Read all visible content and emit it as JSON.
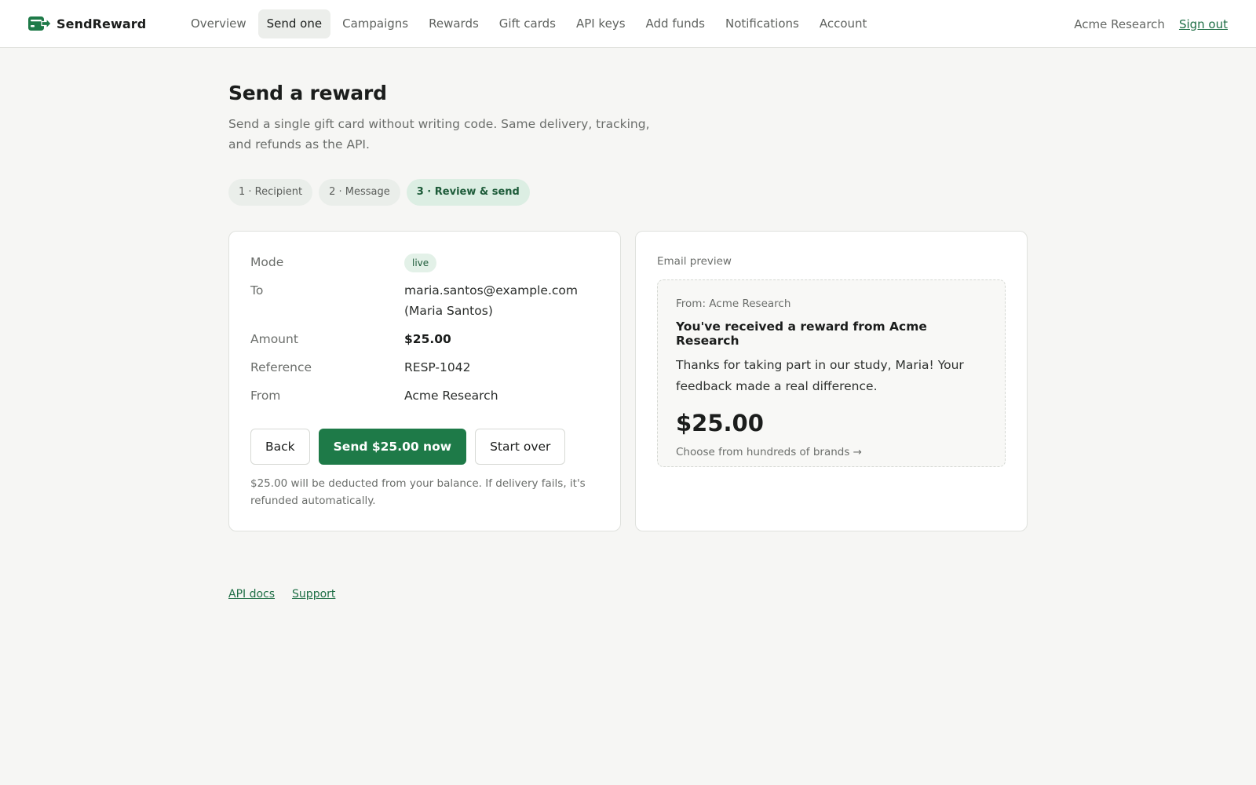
{
  "brand": {
    "name": "SendReward",
    "icon": "card-arrow-icon",
    "accent": "#1e7a48"
  },
  "nav": {
    "items": [
      {
        "label": "Overview"
      },
      {
        "label": "Send one",
        "active": true
      },
      {
        "label": "Campaigns"
      },
      {
        "label": "Rewards"
      },
      {
        "label": "Gift cards"
      },
      {
        "label": "API keys"
      },
      {
        "label": "Add funds"
      },
      {
        "label": "Notifications"
      },
      {
        "label": "Account"
      }
    ],
    "org_name": "Acme Research",
    "sign_out": "Sign out"
  },
  "page": {
    "title": "Send a reward",
    "subtitle": "Send a single gift card without writing code. Same delivery, tracking, and refunds as the API."
  },
  "steps": [
    {
      "label": "1 · Recipient"
    },
    {
      "label": "2 · Message"
    },
    {
      "label": "3 · Review & send",
      "active": true
    }
  ],
  "review": {
    "mode": {
      "label": "Mode",
      "value": "live"
    },
    "to": {
      "label": "To",
      "email": "maria.santos@example.com",
      "name": "(Maria Santos)"
    },
    "amount": {
      "label": "Amount",
      "value": "$25.00"
    },
    "reference": {
      "label": "Reference",
      "value": "RESP-1042"
    },
    "from": {
      "label": "From",
      "value": "Acme Research"
    },
    "buttons": {
      "back": "Back",
      "send": "Send $25.00 now",
      "start_over": "Start over"
    },
    "note": "$25.00 will be deducted from your balance. If delivery fails, it's refunded automatically."
  },
  "preview": {
    "label": "Email preview",
    "from": "From: Acme Research",
    "subject": "You've received a reward from Acme Research",
    "body": "Thanks for taking part in our study, Maria! Your feedback made a real difference.",
    "amount": "$25.00",
    "cta": "Choose from hundreds of brands →"
  },
  "footer": {
    "api_docs": "API docs",
    "support": "Support"
  }
}
